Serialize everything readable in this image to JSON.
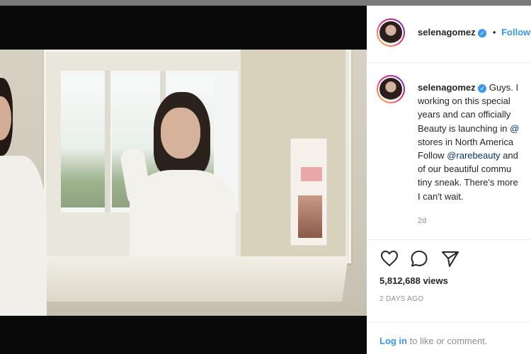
{
  "post": {
    "username": "selenagomez",
    "follow_label": "Follow",
    "dot": "•",
    "caption_lines": [
      "Guys. I",
      "working on this special",
      "years and can officially",
      "Beauty is launching in",
      "stores in North America",
      "Follow",
      "of our beautiful commu",
      "tiny sneak. There's more",
      "I can't wait."
    ],
    "mention_partial": "@",
    "mention": "@rarebeauty",
    "mention_suffix": "and",
    "time_ago": "2d",
    "views": "5,812,688 views",
    "date": "2 DAYS AGO",
    "login_link": "Log in",
    "login_rest": "to like or comment."
  },
  "icons": {
    "like": "heart-icon",
    "comment": "comment-icon",
    "share": "share-icon",
    "verified": "verified-badge-icon"
  },
  "colors": {
    "link": "#3897f0",
    "mention": "#00376b",
    "muted": "#8e8e8e",
    "text": "#262626"
  }
}
